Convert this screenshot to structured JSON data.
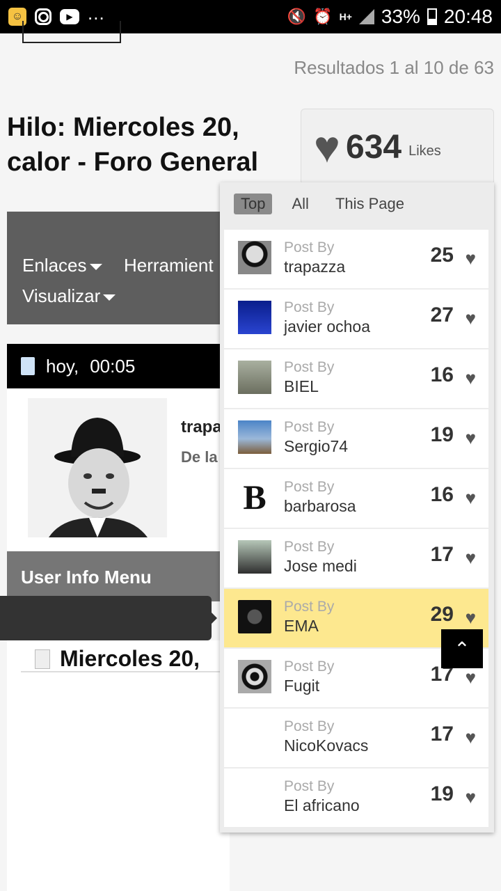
{
  "status_bar": {
    "battery": "33%",
    "time": "20:48",
    "network": "H+",
    "more": "..."
  },
  "page": {
    "results": "Resultados 1 al 10 de 63",
    "thread_title": "Hilo: Miercoles 20, calor - Foro General",
    "menu": {
      "links": "Enlaces",
      "tools": "Herramient",
      "view": "Visualizar"
    },
    "post_date": "hoy,",
    "post_time": "00:05",
    "post_username": "trapa",
    "post_sub": "De la",
    "user_info_menu": "User Info Menu",
    "subject": "Miercoles 20,"
  },
  "likes": {
    "count": "634",
    "label": "Likes",
    "tabs": [
      "Top",
      "All",
      "This Page"
    ],
    "post_by_label": "Post By",
    "rows": [
      {
        "user": "trapazza",
        "count": "25"
      },
      {
        "user": "javier ochoa",
        "count": "27"
      },
      {
        "user": "BIEL",
        "count": "16"
      },
      {
        "user": "Sergio74",
        "count": "19"
      },
      {
        "user": "barbarosa",
        "count": "16"
      },
      {
        "user": "Jose medi",
        "count": "17"
      },
      {
        "user": "EMA",
        "count": "29"
      },
      {
        "user": "Fugit",
        "count": "17"
      },
      {
        "user": "NicoKovacs",
        "count": "17"
      },
      {
        "user": "El africano",
        "count": "19"
      }
    ]
  },
  "icons": {
    "heart": "heart-icon",
    "scroll_top": "chevron-up-icon"
  }
}
